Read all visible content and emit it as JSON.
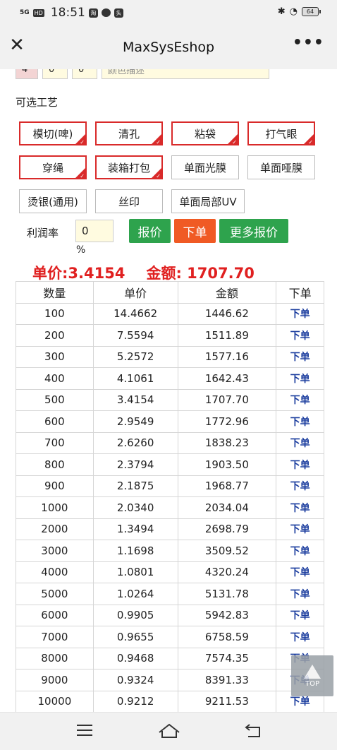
{
  "status_bar": {
    "network": "5G",
    "time": "18:51",
    "battery": "64"
  },
  "nav": {
    "title": "MaxSysEshop",
    "more": "•••"
  },
  "color_row": {
    "v1": "4",
    "v2": "0",
    "v3": "0",
    "description_placeholder": "颜色描述"
  },
  "craft_section": {
    "title": "可选工艺",
    "options": [
      {
        "label": "模切(啤)",
        "selected": true
      },
      {
        "label": "清孔",
        "selected": true
      },
      {
        "label": "粘袋",
        "selected": true
      },
      {
        "label": "打气眼",
        "selected": true
      },
      {
        "label": "穿绳",
        "selected": true
      },
      {
        "label": "装箱打包",
        "selected": true
      },
      {
        "label": "单面光膜",
        "selected": false
      },
      {
        "label": "单面哑膜",
        "selected": false
      },
      {
        "label": "烫银(通用)",
        "selected": false
      },
      {
        "label": "丝印",
        "selected": false
      },
      {
        "label": "单面局部UV",
        "selected": false
      }
    ]
  },
  "profit": {
    "label": "利润率",
    "value": "0",
    "unit": "%"
  },
  "buttons": {
    "quote": "报价",
    "order": "下单",
    "more_quote": "更多报价"
  },
  "summary": {
    "unit_price_label": "单价:",
    "unit_price": "3.4154",
    "amount_label": "金额: ",
    "amount": "1707.70"
  },
  "table": {
    "headers": [
      "数量",
      "单价",
      "金额",
      "下单"
    ],
    "rows": [
      [
        "100",
        "14.4662",
        "1446.62",
        "下单"
      ],
      [
        "200",
        "7.5594",
        "1511.89",
        "下单"
      ],
      [
        "300",
        "5.2572",
        "1577.16",
        "下单"
      ],
      [
        "400",
        "4.1061",
        "1642.43",
        "下单"
      ],
      [
        "500",
        "3.4154",
        "1707.70",
        "下单"
      ],
      [
        "600",
        "2.9549",
        "1772.96",
        "下单"
      ],
      [
        "700",
        "2.6260",
        "1838.23",
        "下单"
      ],
      [
        "800",
        "2.3794",
        "1903.50",
        "下单"
      ],
      [
        "900",
        "2.1875",
        "1968.77",
        "下单"
      ],
      [
        "1000",
        "2.0340",
        "2034.04",
        "下单"
      ],
      [
        "2000",
        "1.3494",
        "2698.79",
        "下单"
      ],
      [
        "3000",
        "1.1698",
        "3509.52",
        "下单"
      ],
      [
        "4000",
        "1.0801",
        "4320.24",
        "下单"
      ],
      [
        "5000",
        "1.0264",
        "5131.78",
        "下单"
      ],
      [
        "6000",
        "0.9905",
        "5942.83",
        "下单"
      ],
      [
        "7000",
        "0.9655",
        "6758.59",
        "下单"
      ],
      [
        "8000",
        "0.9468",
        "7574.35",
        "下单"
      ],
      [
        "9000",
        "0.9324",
        "8391.33",
        "下单"
      ],
      [
        "10000",
        "0.9212",
        "9211.53",
        "下单"
      ]
    ]
  },
  "top_button": {
    "label": "TOP"
  },
  "colors": {
    "accent_red": "#d92a2a",
    "green": "#2ea34d",
    "orange": "#f05a24",
    "link_blue": "#1a3c9e"
  }
}
